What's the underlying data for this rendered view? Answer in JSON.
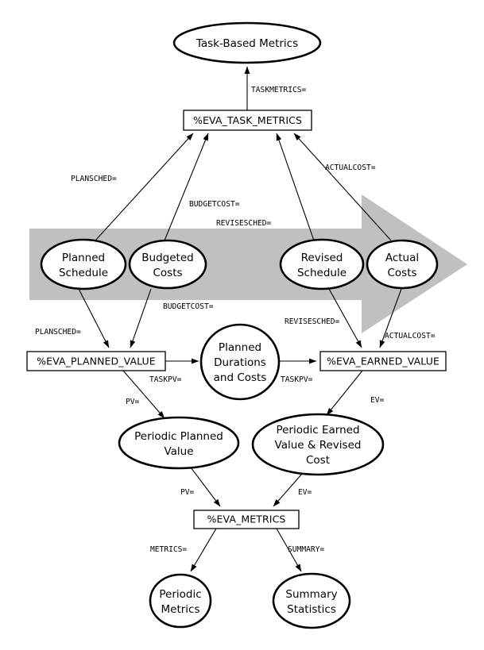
{
  "diagram": {
    "title": "Task-Based Metrics Earned Value Analysis flow",
    "band": {
      "name": "time-progression-arrow",
      "color": "#c0c0c0"
    },
    "nodes": {
      "task_based_metrics": "Task-Based Metrics",
      "eva_task_metrics": "%EVA_TASK_METRICS",
      "planned_schedule": "Planned\nSchedule",
      "planned_schedule_l1": "Planned",
      "planned_schedule_l2": "Schedule",
      "budgeted_costs_l1": "Budgeted",
      "budgeted_costs_l2": "Costs",
      "revised_schedule_l1": "Revised",
      "revised_schedule_l2": "Schedule",
      "actual_costs_l1": "Actual",
      "actual_costs_l2": "Costs",
      "eva_planned_value": "%EVA_PLANNED_VALUE",
      "eva_earned_value": "%EVA_EARNED_VALUE",
      "planned_durations_l1": "Planned",
      "planned_durations_l2": "Durations",
      "planned_durations_l3": "and Costs",
      "periodic_planned_value_l1": "Periodic Planned",
      "periodic_planned_value_l2": "Value",
      "periodic_earned_l1": "Periodic Earned",
      "periodic_earned_l2": "Value & Revised",
      "periodic_earned_l3": "Cost",
      "eva_metrics": "%EVA_METRICS",
      "periodic_metrics_l1": "Periodic",
      "periodic_metrics_l2": "Metrics",
      "summary_statistics_l1": "Summary",
      "summary_statistics_l2": "Statistics"
    },
    "edge_labels": {
      "taskmetrics": "TASKMETRICS=",
      "plansched_top": "PLANSCHED=",
      "budgetcost_top": "BUDGETCOST=",
      "revisesched_top": "REVISESCHED=",
      "actualcost_top": "ACTUALCOST=",
      "plansched_low": "PLANSCHED=",
      "budgetcost_low": "BUDGETCOST=",
      "revisesched_low": "REVISESCHED=",
      "actualcost_low": "ACTUALCOST=",
      "taskpv_left": "TASKPV=",
      "taskpv_right": "TASKPV=",
      "pv_mid": "PV=",
      "ev_mid": "EV=",
      "pv_low": "PV=",
      "ev_low": "EV=",
      "metrics": "METRICS=",
      "summary": "SUMMARY="
    }
  }
}
